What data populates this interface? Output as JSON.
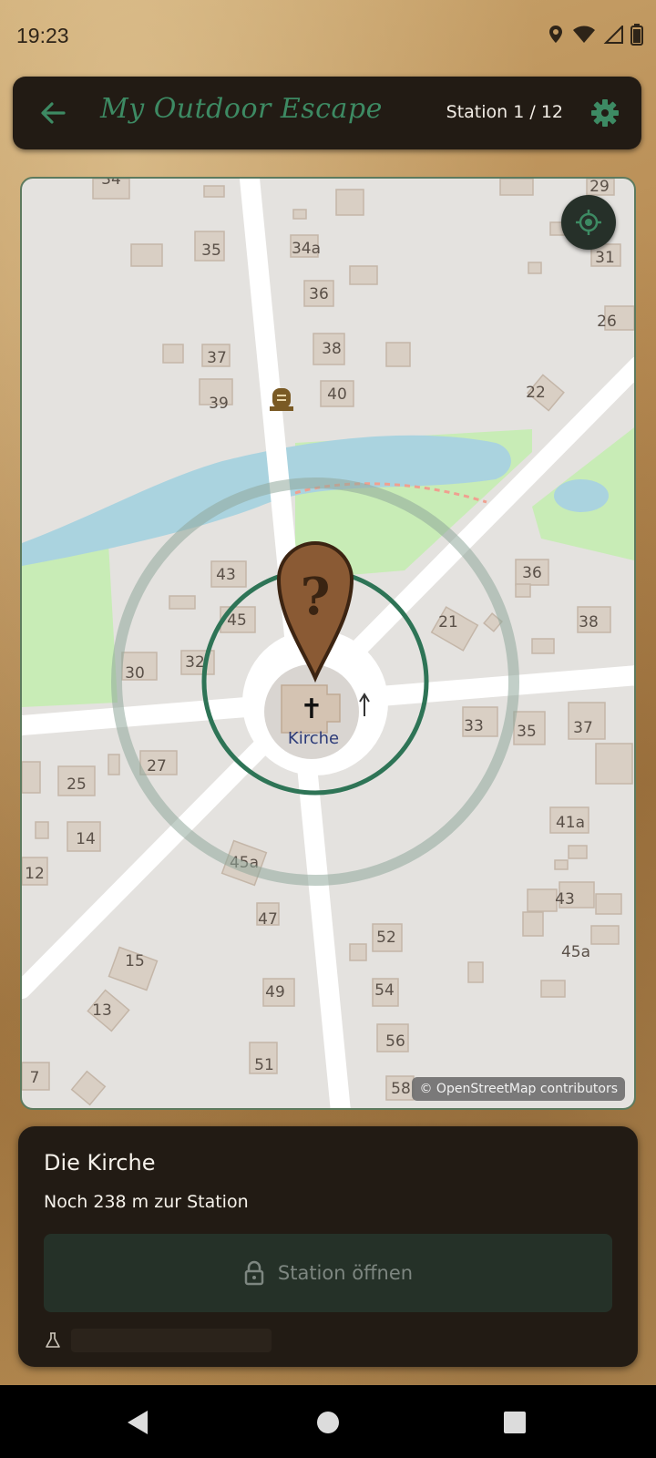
{
  "status_bar": {
    "time": "19:23",
    "icons": [
      "location-icon",
      "wifi-icon",
      "signal-icon",
      "battery-icon"
    ]
  },
  "header": {
    "back_icon": "arrow-left-icon",
    "title": "My Outdoor Escape",
    "station_counter": "Station 1 / 12",
    "settings_icon": "gear-icon"
  },
  "map": {
    "locate_icon": "crosshair-icon",
    "marker_icon": "question-pin-icon",
    "poi_label": "Kirche",
    "credit": "© OpenStreetMap contributors",
    "house_numbers": [
      "34",
      "29",
      "35",
      "34a",
      "31",
      "36",
      "26",
      "37",
      "38",
      "39",
      "40",
      "22",
      "43",
      "36",
      "45",
      "21",
      "38",
      "30",
      "32",
      "33",
      "35",
      "37",
      "27",
      "25",
      "14",
      "12",
      "45a",
      "41a",
      "47",
      "52",
      "43",
      "45a",
      "15",
      "49",
      "54",
      "13",
      "51",
      "56",
      "7",
      "58"
    ]
  },
  "panel": {
    "station_name": "Die Kirche",
    "distance_text": "Noch 238 m zur Station",
    "open_button_label": "Station öffnen",
    "open_button_icon": "lock-icon",
    "debug_icon": "flask-icon"
  },
  "nav_bar": {
    "icons": [
      "back-triangle-icon",
      "home-circle-icon",
      "recents-square-icon"
    ]
  },
  "colors": {
    "accent_green": "#3d8a63",
    "dark_panel": "#221b14",
    "disabled_button": "#253128",
    "map_water": "#aad3df",
    "map_park": "#c8f0b0"
  }
}
